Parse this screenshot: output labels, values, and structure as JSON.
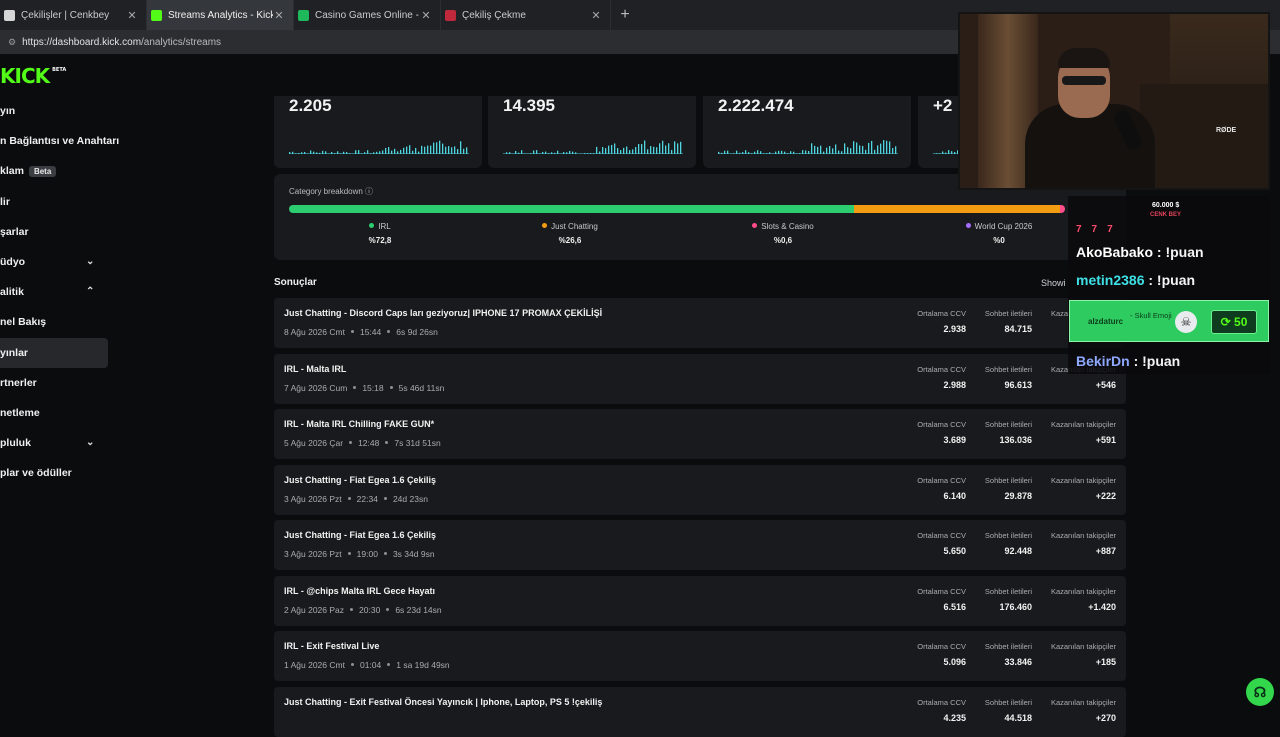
{
  "browser": {
    "tabs": [
      {
        "title": "Çekilişler | Cenkbey",
        "icon_color": "#d6d6d6"
      },
      {
        "title": "Streams Analytics - Kick Dashboar",
        "icon_color": "#53fc18"
      },
      {
        "title": "Casino Games Online - Play Slots,",
        "icon_color": "#1fb85a"
      },
      {
        "title": "Çekiliş Çekme",
        "icon_color": "#c0283c"
      }
    ],
    "close_glyph": "✕",
    "new_tab_glyph": "+",
    "url_host": "https://dashboard.kick.com",
    "url_path": "/analytics/streams"
  },
  "logo": {
    "text": "KICK",
    "beta": "BETA"
  },
  "sidebar": {
    "items": [
      {
        "label": "yın"
      },
      {
        "label": "n Bağlantısı ve Anahtarı"
      },
      {
        "label": "klam",
        "badge": "Beta"
      },
      {
        "label": "lir"
      },
      {
        "label": "şarlar"
      },
      {
        "label": "üdyo",
        "chevron": "⌄"
      },
      {
        "label": "alitik",
        "chevron": "⌃"
      },
      {
        "label": "nel Bakış"
      },
      {
        "label": "yınlar",
        "active": true
      },
      {
        "label": "rtnerler"
      },
      {
        "label": "netleme"
      },
      {
        "label": "pluluk",
        "chevron": "⌄"
      },
      {
        "label": "plar ve ödüller"
      }
    ]
  },
  "stats": [
    {
      "value": "2.205"
    },
    {
      "value": "14.395"
    },
    {
      "value": "2.222.474"
    },
    {
      "value": "+2"
    }
  ],
  "category": {
    "title": "Category breakdown ⓘ",
    "items": [
      {
        "label": "IRL",
        "value": "%72,8",
        "share": 72.8,
        "color": "#2ecc71"
      },
      {
        "label": "Just Chatting",
        "value": "%26,6",
        "share": 26.6,
        "color": "#f39c12"
      },
      {
        "label": "Slots & Casino",
        "value": "%0,6",
        "share": 0.6,
        "color": "#ff4d8a"
      },
      {
        "label": "World Cup 2026",
        "value": "%0",
        "share": 0,
        "color": "#a66bff"
      }
    ]
  },
  "results": {
    "title": "Sonuçlar",
    "shows_label": "Showi",
    "col_ccv": "Ortalama CCV",
    "col_chat": "Sohbet iletileri",
    "col_followers": "Kazanılan takipçiler",
    "rows": [
      {
        "title": "Just Chatting - Discord Caps ları geziyoruz| IPHONE 17 PROMAX ÇEKİLİŞİ",
        "date": "8 Ağu 2026 Cmt",
        "time": "15:44",
        "duration": "6s 9d 26sn",
        "ccv": "2.938",
        "chat": "84.715",
        "followers": ""
      },
      {
        "title": "IRL - Malta IRL",
        "date": "7 Ağu 2026 Cum",
        "time": "15:18",
        "duration": "5s 46d 11sn",
        "ccv": "2.988",
        "chat": "96.613",
        "followers": "+546"
      },
      {
        "title": "IRL - Malta IRL Chilling FAKE GUN*",
        "date": "5 Ağu 2026 Çar",
        "time": "12:48",
        "duration": "7s 31d 51sn",
        "ccv": "3.689",
        "chat": "136.036",
        "followers": "+591"
      },
      {
        "title": "Just Chatting - Fiat Egea 1.6 Çekiliş",
        "date": "3 Ağu 2026 Pzt",
        "time": "22:34",
        "duration": "24d 23sn",
        "ccv": "6.140",
        "chat": "29.878",
        "followers": "+222"
      },
      {
        "title": "Just Chatting - Fiat Egea 1.6 Çekiliş",
        "date": "3 Ağu 2026 Pzt",
        "time": "19:00",
        "duration": "3s 34d 9sn",
        "ccv": "5.650",
        "chat": "92.448",
        "followers": "+887"
      },
      {
        "title": "IRL - @chips Malta IRL Gece Hayatı",
        "date": "2 Ağu 2026 Paz",
        "time": "20:30",
        "duration": "6s 23d 14sn",
        "ccv": "6.516",
        "chat": "176.460",
        "followers": "+1.420"
      },
      {
        "title": "IRL - Exit Festival Live",
        "date": "1 Ağu 2026 Cmt",
        "time": "01:04",
        "duration": "1 sa 19d 49sn",
        "ccv": "5.096",
        "chat": "33.846",
        "followers": "+185"
      },
      {
        "title": "Just Chatting - Exit Festival Öncesi Yayıncık | Iphone, Laptop, PS 5 !çekiliş",
        "date": "",
        "time": "",
        "duration": "",
        "ccv": "4.235",
        "chat": "44.518",
        "followers": "+270"
      }
    ]
  },
  "overlay": {
    "goal_amount": "60.000 $",
    "goal_name": "CENK BEY",
    "badges": "777",
    "messages": [
      {
        "user": "AkoBabako",
        "text": " : !puan"
      },
      {
        "user": "metin2386",
        "text": " : !puan"
      },
      {
        "user": "BekirDn",
        "text": " : !puan"
      }
    ],
    "tip": {
      "user": "alzdaturc",
      "text": "- Skull Emoji",
      "amount": "50"
    },
    "rode_label": "RØDE"
  },
  "help_icon": "headset-icon"
}
